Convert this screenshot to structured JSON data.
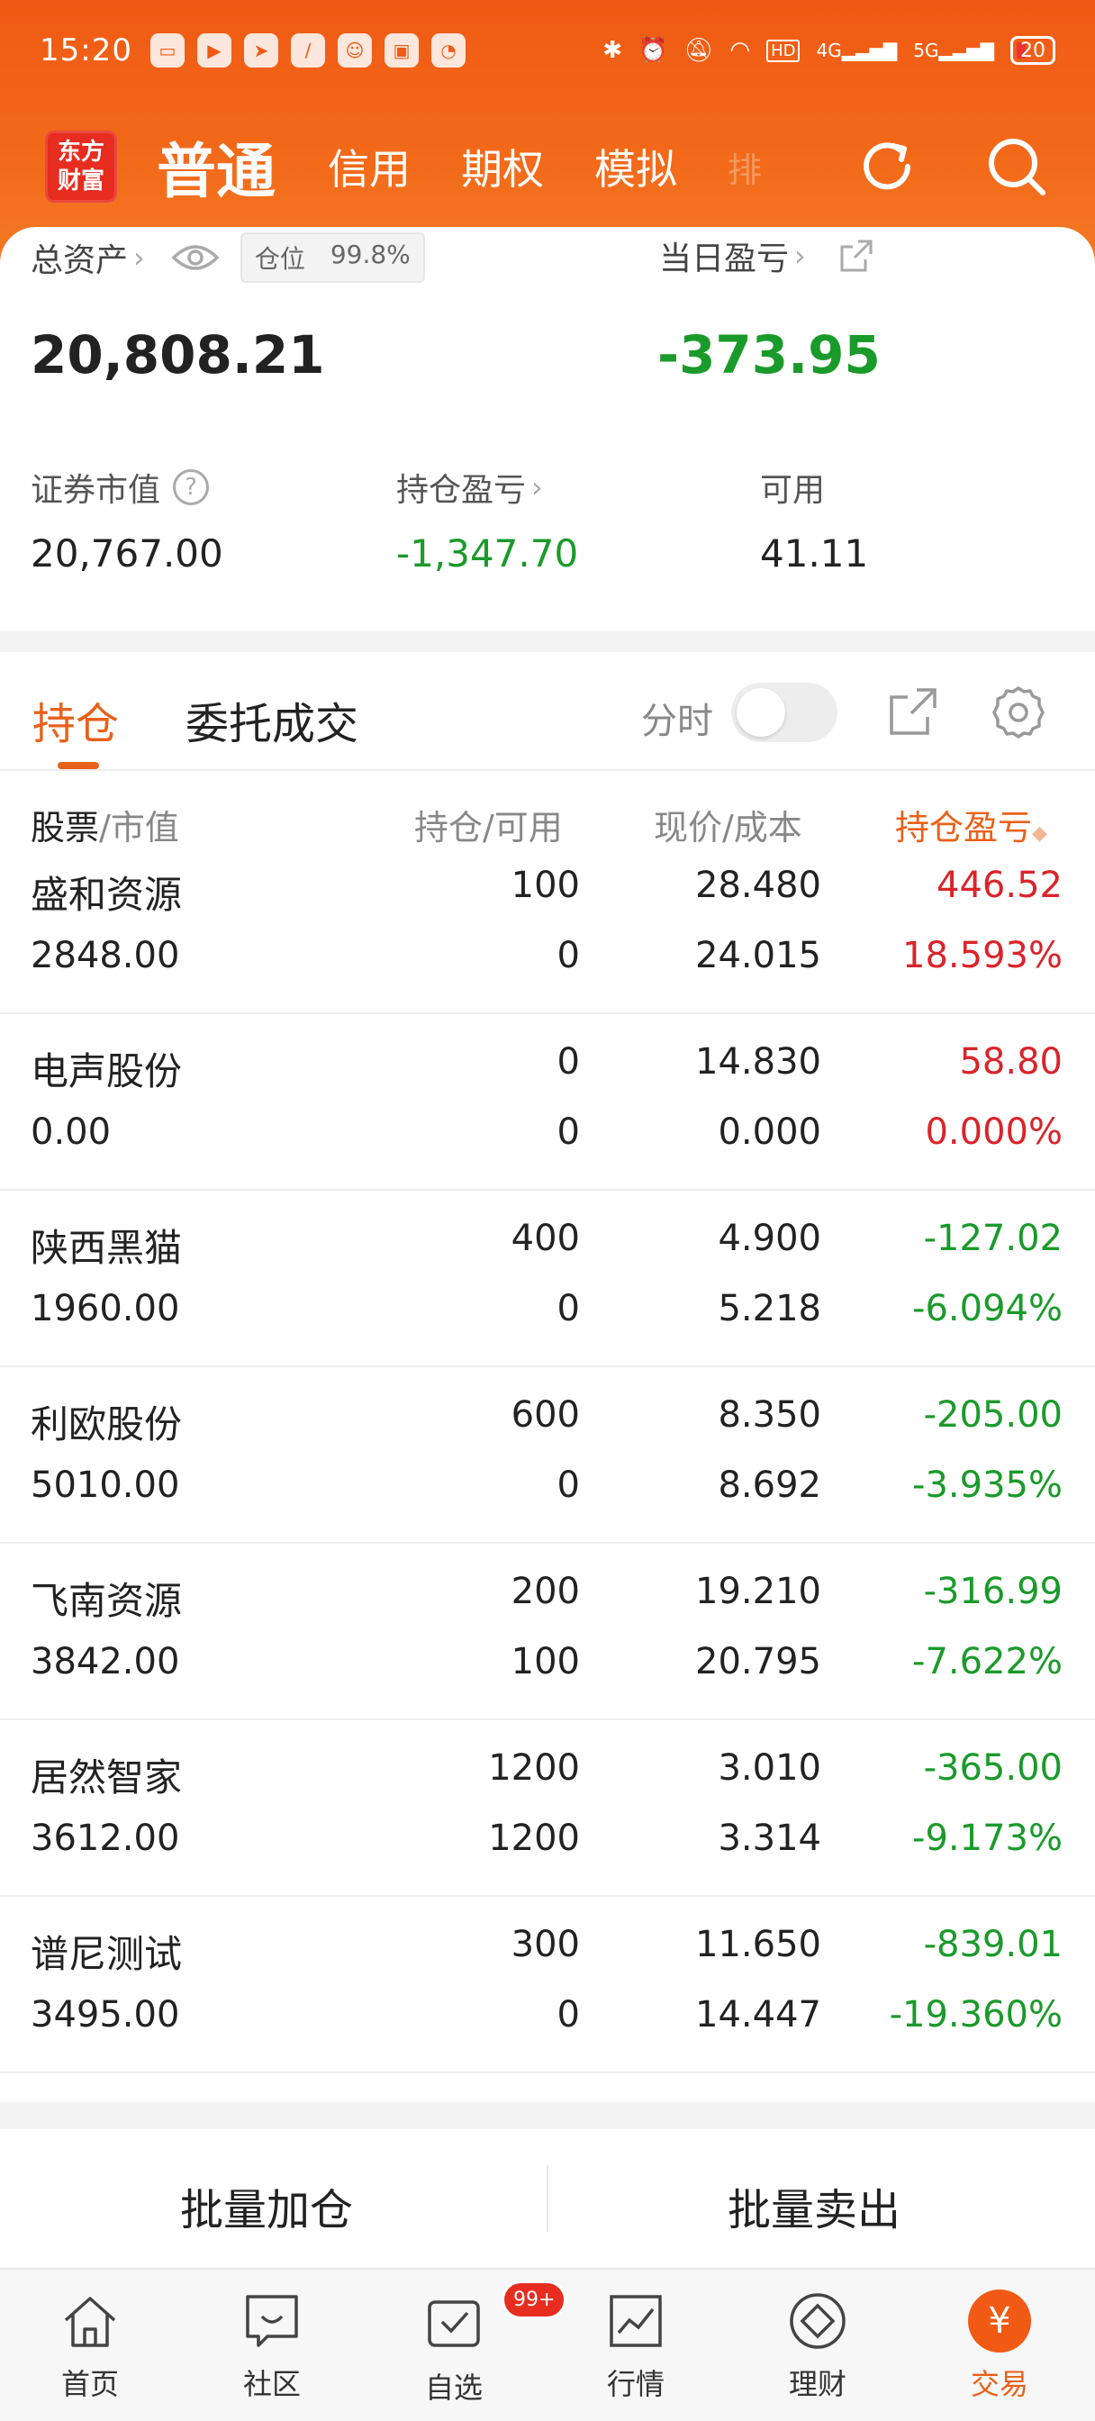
{
  "status_bar": {
    "time": "15:20",
    "battery": "20",
    "network_4g": "4G",
    "network_5g": "5G",
    "hd": "HD"
  },
  "nav": {
    "logo_line1": "东方",
    "logo_line2": "财富",
    "tabs": [
      {
        "label": "普通",
        "active": true
      },
      {
        "label": "信用",
        "active": false
      },
      {
        "label": "期权",
        "active": false
      },
      {
        "label": "模拟",
        "active": false
      }
    ],
    "more_label": "排"
  },
  "summary": {
    "total_assets_label": "总资产",
    "position_label": "仓位",
    "position_value": "99.8%",
    "total_assets": "20,808.21",
    "daily_pl_label": "当日盈亏",
    "daily_pl": "-373.95",
    "market_value_label": "证券市值",
    "market_value": "20,767.00",
    "holding_pl_label": "持仓盈亏",
    "holding_pl": "-1,347.70",
    "available_label": "可用",
    "available": "41.11"
  },
  "tabs": {
    "holdings": "持仓",
    "orders": "委托成交",
    "fenshi": "分时"
  },
  "columns": {
    "stock": "股票",
    "stock_sub": "/市值",
    "qty": "持仓/可用",
    "price": "现价/成本",
    "pl": "持仓盈亏"
  },
  "holdings": [
    {
      "name": "盛和资源",
      "market_value": "2848.00",
      "qty": "100",
      "available": "0",
      "price": "28.480",
      "cost": "24.015",
      "pl": "446.52",
      "pl_pct": "18.593%",
      "direction": "up"
    },
    {
      "name": "电声股份",
      "market_value": "0.00",
      "qty": "0",
      "available": "0",
      "price": "14.830",
      "cost": "0.000",
      "pl": "58.80",
      "pl_pct": "0.000%",
      "direction": "up"
    },
    {
      "name": "陕西黑猫",
      "market_value": "1960.00",
      "qty": "400",
      "available": "0",
      "price": "4.900",
      "cost": "5.218",
      "pl": "-127.02",
      "pl_pct": "-6.094%",
      "direction": "down"
    },
    {
      "name": "利欧股份",
      "market_value": "5010.00",
      "qty": "600",
      "available": "0",
      "price": "8.350",
      "cost": "8.692",
      "pl": "-205.00",
      "pl_pct": "-3.935%",
      "direction": "down"
    },
    {
      "name": "飞南资源",
      "market_value": "3842.00",
      "qty": "200",
      "available": "100",
      "price": "19.210",
      "cost": "20.795",
      "pl": "-316.99",
      "pl_pct": "-7.622%",
      "direction": "down"
    },
    {
      "name": "居然智家",
      "market_value": "3612.00",
      "qty": "1200",
      "available": "1200",
      "price": "3.010",
      "cost": "3.314",
      "pl": "-365.00",
      "pl_pct": "-9.173%",
      "direction": "down"
    },
    {
      "name": "谱尼测试",
      "market_value": "3495.00",
      "qty": "300",
      "available": "0",
      "price": "11.650",
      "cost": "14.447",
      "pl": "-839.01",
      "pl_pct": "-19.360%",
      "direction": "down"
    }
  ],
  "actions": {
    "batch_buy": "批量加仓",
    "batch_sell": "批量卖出"
  },
  "tabbar": [
    {
      "label": "首页",
      "icon": "home-icon"
    },
    {
      "label": "社区",
      "icon": "community-icon"
    },
    {
      "label": "自选",
      "icon": "watchlist-icon",
      "badge": "99+"
    },
    {
      "label": "行情",
      "icon": "market-icon"
    },
    {
      "label": "理财",
      "icon": "wealth-icon"
    },
    {
      "label": "交易",
      "icon": "trade-icon",
      "active": true
    }
  ],
  "trade_glyph": "¥",
  "colors": {
    "brand": "#f05a14",
    "gain": "#d9242b",
    "loss": "#1a9a2a",
    "active_tab": "#e8611a"
  }
}
